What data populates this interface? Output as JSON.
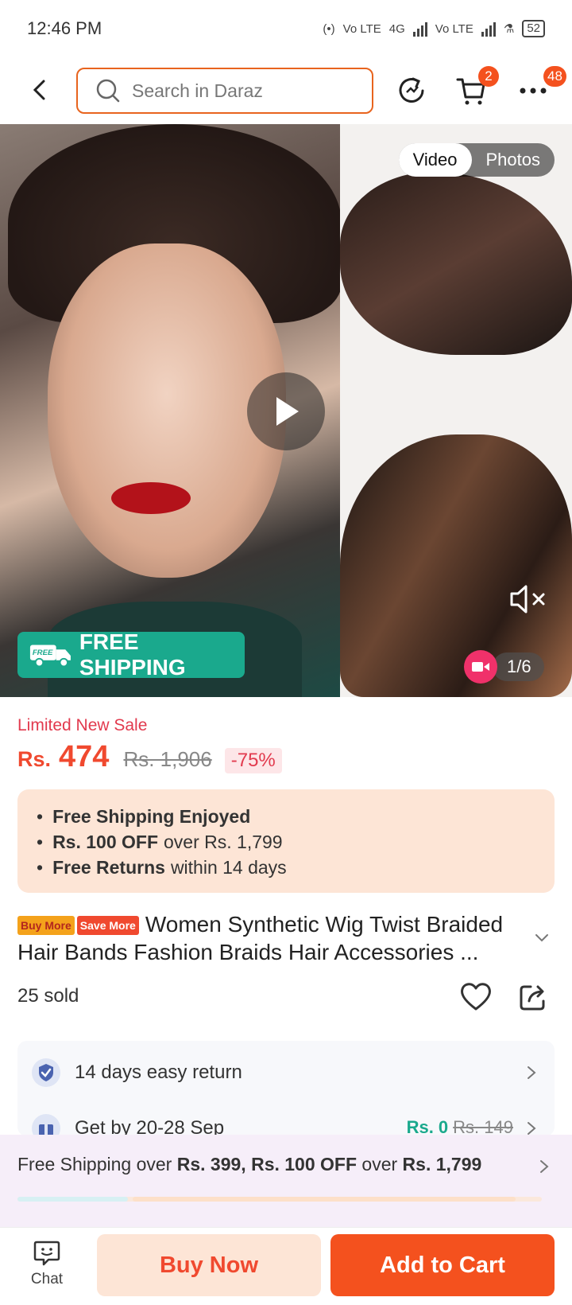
{
  "status_bar": {
    "time": "12:46 PM",
    "battery": "52",
    "net1": "Vo LTE",
    "net2": "4G",
    "net3": "Vo LTE"
  },
  "search": {
    "placeholder": "Search in Daraz"
  },
  "header": {
    "cart_badge": "2",
    "more_badge": "48"
  },
  "gallery": {
    "tab_video": "Video",
    "tab_photos": "Photos",
    "active_tab": "Video",
    "free_shipping_tag": "FREE",
    "free_shipping_label": "FREE SHIPPING",
    "counter": "1/6"
  },
  "pricing": {
    "sale_label": "Limited New Sale",
    "currency": "Rs.",
    "price": "474",
    "original_price": "Rs. 1,906",
    "discount": "-75%"
  },
  "perks": [
    {
      "bold": "Free Shipping Enjoyed",
      "rest": ""
    },
    {
      "bold": "Rs. 100 OFF",
      "rest": "over Rs. 1,799"
    },
    {
      "bold": "Free Returns",
      "rest": "within 14 days"
    }
  ],
  "product": {
    "promo_tag_1": "Buy More",
    "promo_tag_2": "Save More",
    "title": "Women Synthetic Wig Twist Braided Hair Bands Fashion Braids Hair Accessories ...",
    "sold": "25 sold"
  },
  "services": {
    "return_label": "14 days easy return",
    "delivery_label": "Get by 20-28 Sep",
    "delivery_fee": "Rs. 0",
    "delivery_fee_was": "Rs. 149"
  },
  "shipping_promo": {
    "prefix": "Free Shipping over",
    "threshold_1": "Rs. 399,",
    "offer": "Rs. 100 OFF",
    "mid": "over",
    "threshold_2": "Rs. 1,799",
    "progress_segment_1": 0.21,
    "progress_segment_2": 0.73
  },
  "bottom_bar": {
    "chat": "Chat",
    "buy_now": "Buy Now",
    "add_to_cart": "Add to Cart"
  },
  "colors": {
    "accent": "#f4511e",
    "price": "#f0492f",
    "green": "#1aa98d",
    "pink": "#e23a4e"
  }
}
